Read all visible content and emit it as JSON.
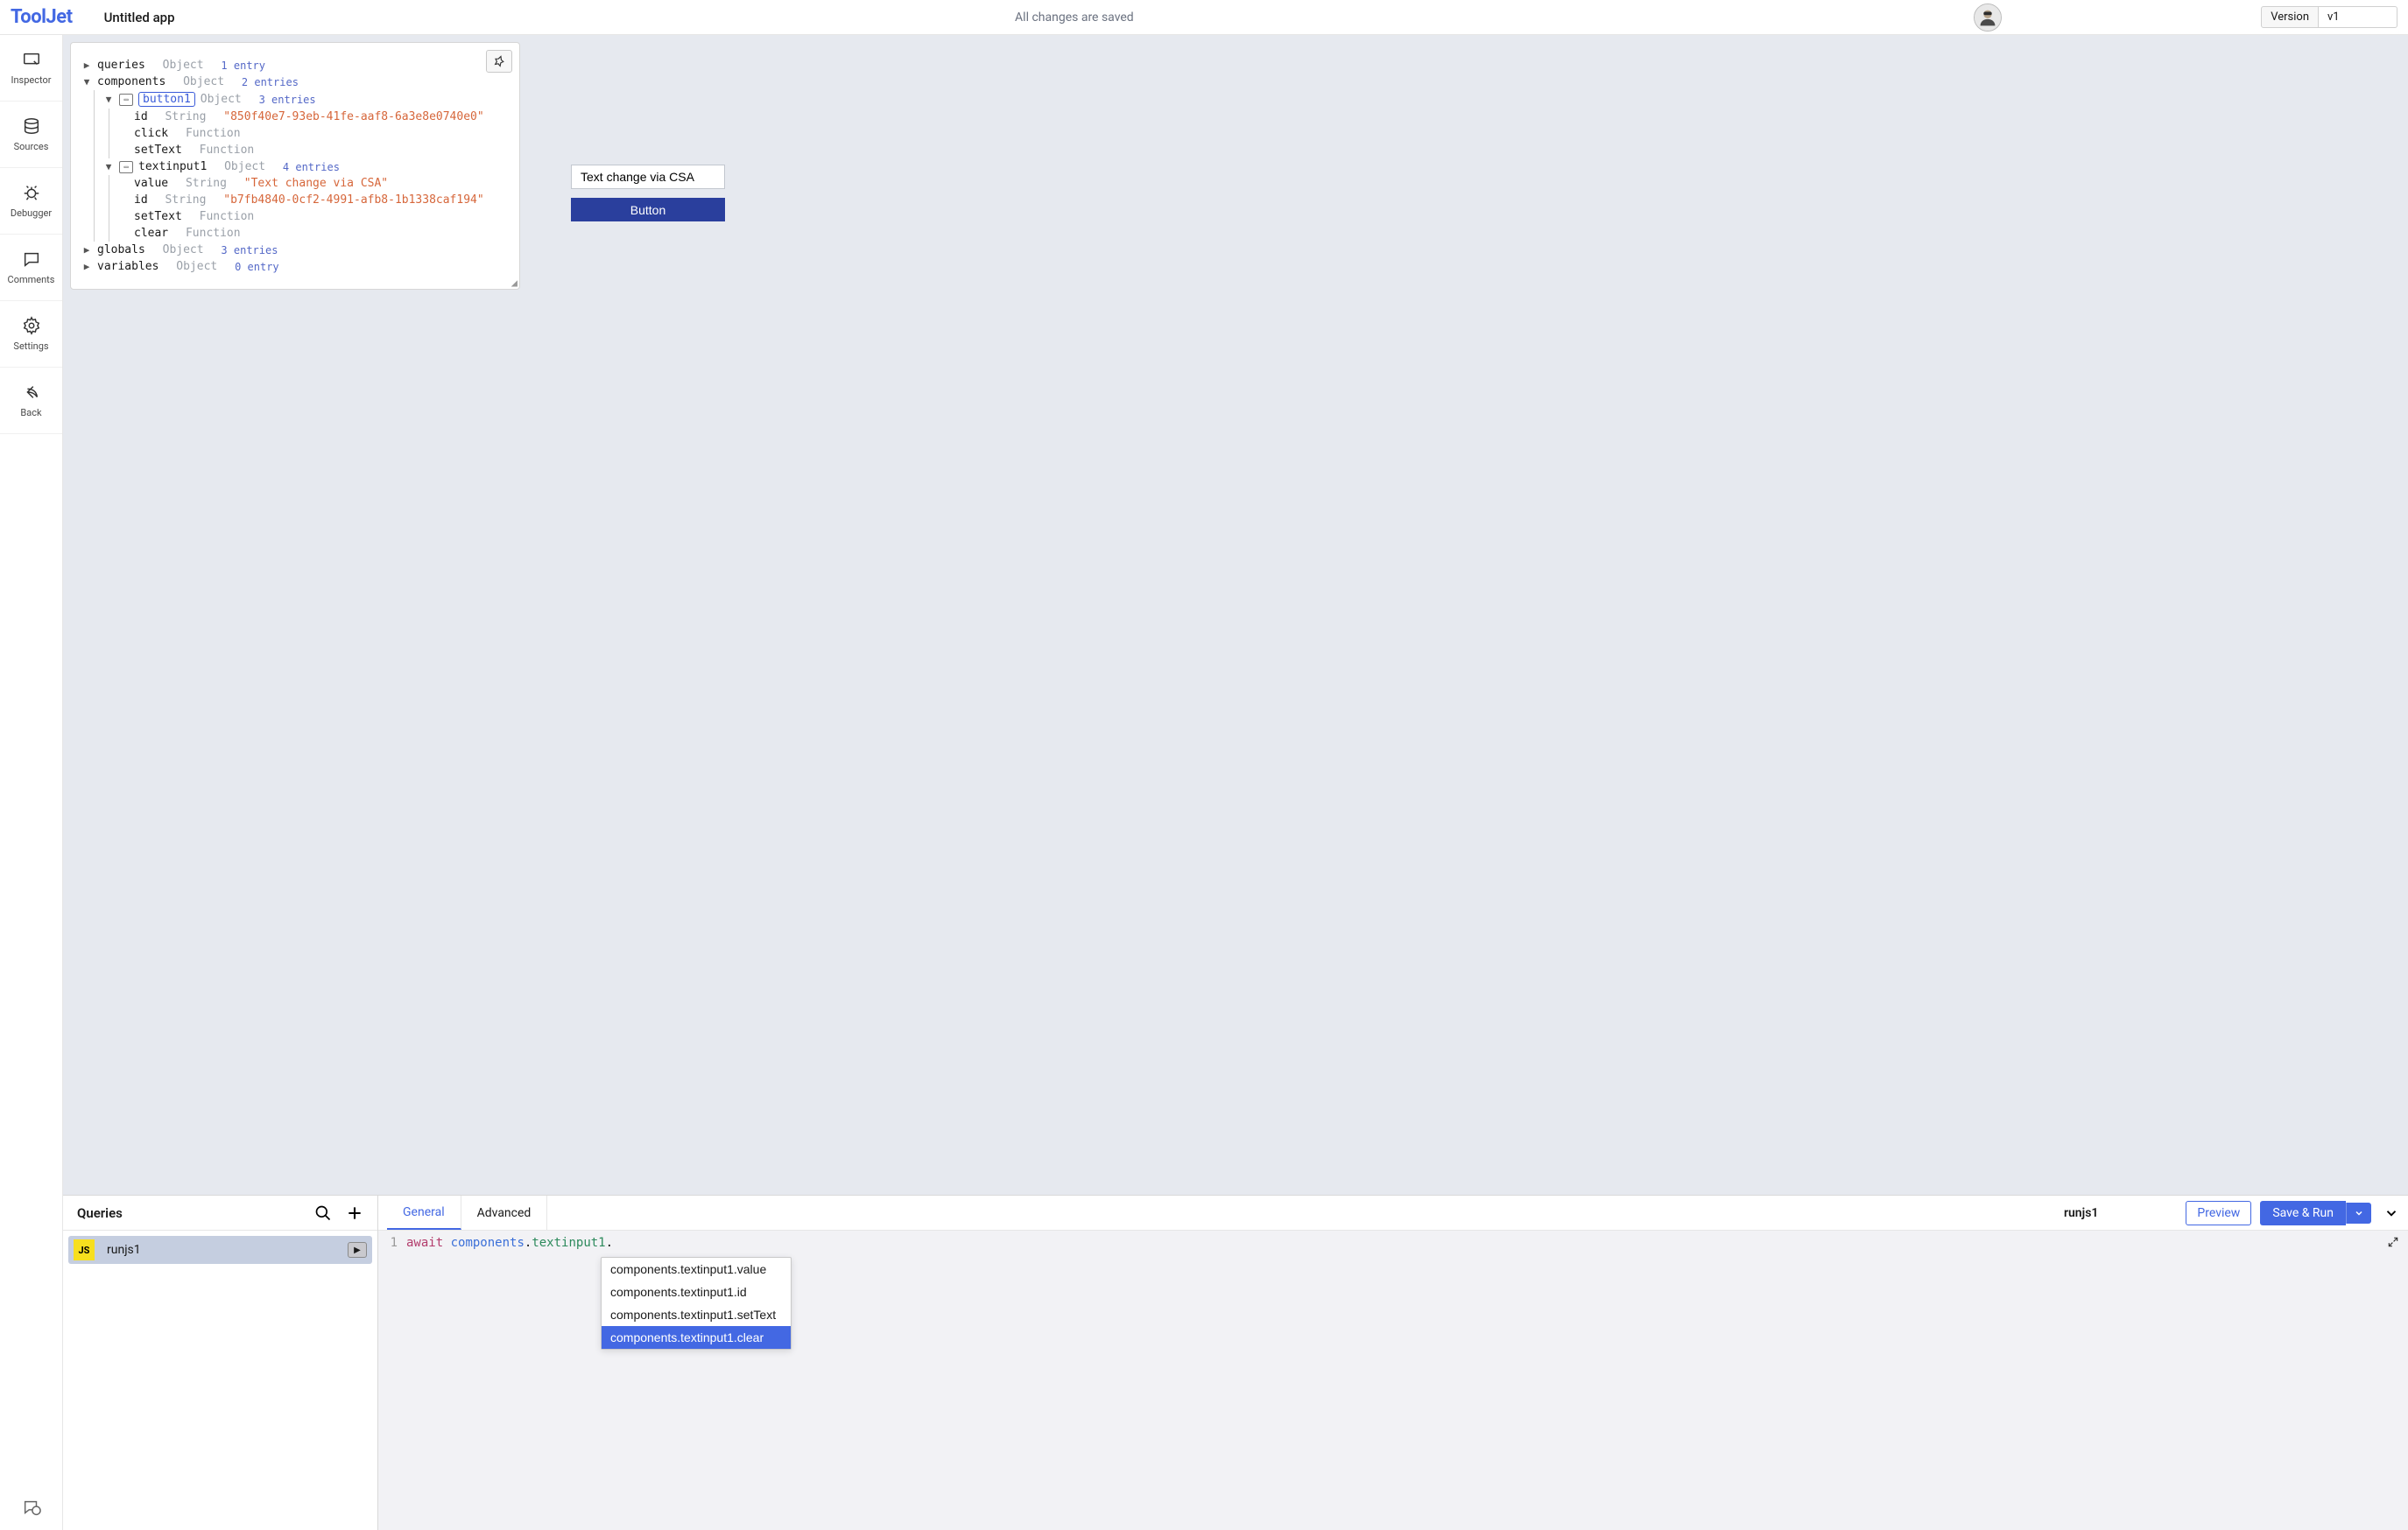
{
  "header": {
    "logo": "ToolJet",
    "appTitle": "Untitled app",
    "saveStatus": "All changes are saved",
    "versionLabel": "Version",
    "versionValue": "v1"
  },
  "sidebar": {
    "inspector": "Inspector",
    "sources": "Sources",
    "debugger": "Debugger",
    "comments": "Comments",
    "settings": "Settings",
    "back": "Back"
  },
  "inspectorTree": {
    "queries": {
      "key": "queries",
      "type": "Object",
      "meta": "1 entry"
    },
    "components": {
      "key": "components",
      "type": "Object",
      "meta": "2 entries"
    },
    "button1": {
      "key": "button1",
      "type": "Object",
      "meta": "3 entries"
    },
    "button1_id": {
      "key": "id",
      "type": "String",
      "val": "\"850f40e7-93eb-41fe-aaf8-6a3e8e0740e0\""
    },
    "button1_click": {
      "key": "click",
      "type": "Function"
    },
    "button1_setText": {
      "key": "setText",
      "type": "Function"
    },
    "textinput1": {
      "key": "textinput1",
      "type": "Object",
      "meta": "4 entries"
    },
    "textinput1_value": {
      "key": "value",
      "type": "String",
      "val": "\"Text change via CSA\""
    },
    "textinput1_id": {
      "key": "id",
      "type": "String",
      "val": "\"b7fb4840-0cf2-4991-afb8-1b1338caf194\""
    },
    "textinput1_setText": {
      "key": "setText",
      "type": "Function"
    },
    "textinput1_clear": {
      "key": "clear",
      "type": "Function"
    },
    "globals": {
      "key": "globals",
      "type": "Object",
      "meta": "3 entries"
    },
    "variables": {
      "key": "variables",
      "type": "Object",
      "meta": "0 entry"
    }
  },
  "canvas": {
    "textInputValue": "Text change via CSA",
    "buttonLabel": "Button"
  },
  "queries": {
    "panelTitle": "Queries",
    "items": [
      {
        "name": "runjs1",
        "badge": "JS"
      }
    ],
    "tabs": {
      "general": "General",
      "advanced": "Advanced"
    },
    "activeQueryTitle": "runjs1",
    "previewBtn": "Preview",
    "saveRunBtn": "Save & Run"
  },
  "code": {
    "lineNo": "1",
    "kw": "await",
    "obj": "components",
    "dot1": ".",
    "prop": "textinput1",
    "dot2": "."
  },
  "autocomplete": {
    "opt1": "components.textinput1.value",
    "opt2": "components.textinput1.id",
    "opt3": "components.textinput1.setText",
    "opt4": "components.textinput1.clear"
  }
}
